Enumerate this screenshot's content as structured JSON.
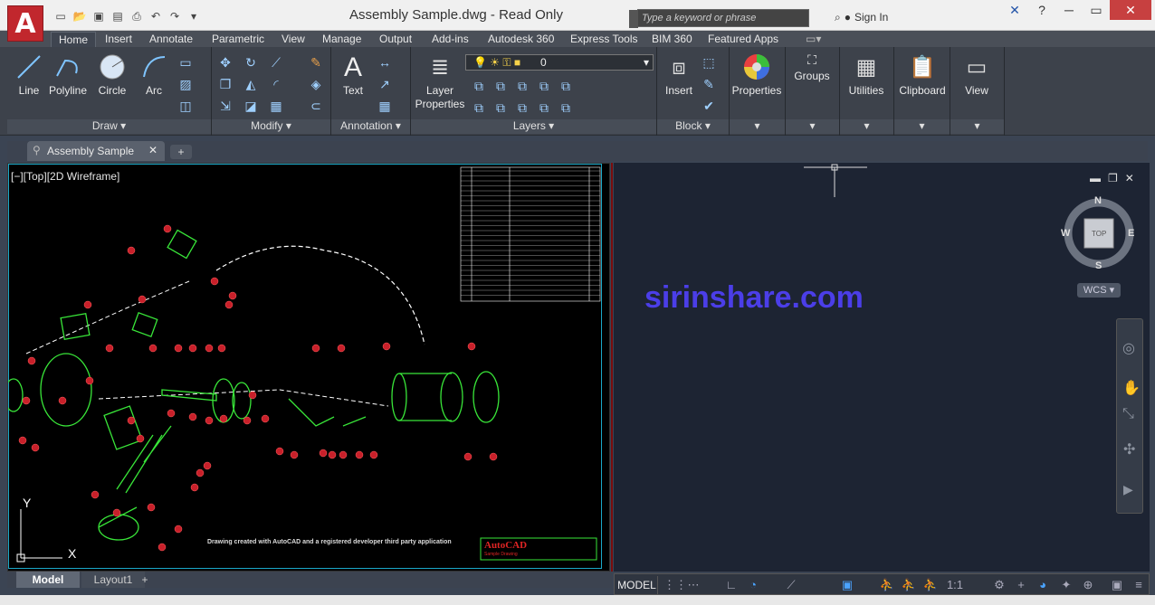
{
  "title": "Assembly Sample.dwg - Read Only",
  "app_logo": "A",
  "search": {
    "placeholder": "Type a keyword or phrase"
  },
  "signin": "Sign In",
  "ribbon_tabs": [
    "Home",
    "Insert",
    "Annotate",
    "Parametric",
    "View",
    "Manage",
    "Output",
    "Add-ins",
    "Autodesk 360",
    "Express Tools",
    "BIM 360",
    "Featured Apps"
  ],
  "draw": {
    "panel_label": "Draw ▾",
    "line": "Line",
    "polyline": "Polyline",
    "circle": "Circle",
    "arc": "Arc"
  },
  "modify": {
    "panel_label": "Modify ▾"
  },
  "annotation": {
    "panel_label": "Annotation ▾",
    "text": "Text"
  },
  "layers": {
    "panel_label": "Layers ▾",
    "layer_properties_1": "Layer",
    "layer_properties_2": "Properties",
    "current_layer": "0"
  },
  "block": {
    "panel_label": "Block ▾",
    "insert": "Insert"
  },
  "properties": {
    "label": "Properties"
  },
  "groups": {
    "label": "Groups"
  },
  "utilities": {
    "label": "Utilities"
  },
  "clipboard": {
    "label": "Clipboard"
  },
  "view": {
    "label": "View"
  },
  "doc_tab": "Assembly Sample",
  "viewport_label": "[−][Top][2D Wireframe]",
  "watermark": "sirinshare.com",
  "viewcube": {
    "n": "N",
    "s": "S",
    "e": "E",
    "w": "W",
    "top": "TOP"
  },
  "wcs": "WCS",
  "layout_tabs": {
    "model": "Model",
    "layout1": "Layout1"
  },
  "status": {
    "model": "MODEL",
    "scale": "1:1"
  },
  "drawing_caption": "Drawing created with AutoCAD and a registered developer third party application",
  "titleblock_brand": "AutoCAD",
  "titleblock_sub": "Sample Drawing",
  "colors": {
    "accent": "#c1272d",
    "drawing_green": "#39e639",
    "balloon_red": "#c8202a",
    "watermark": "#4b3ee8"
  }
}
